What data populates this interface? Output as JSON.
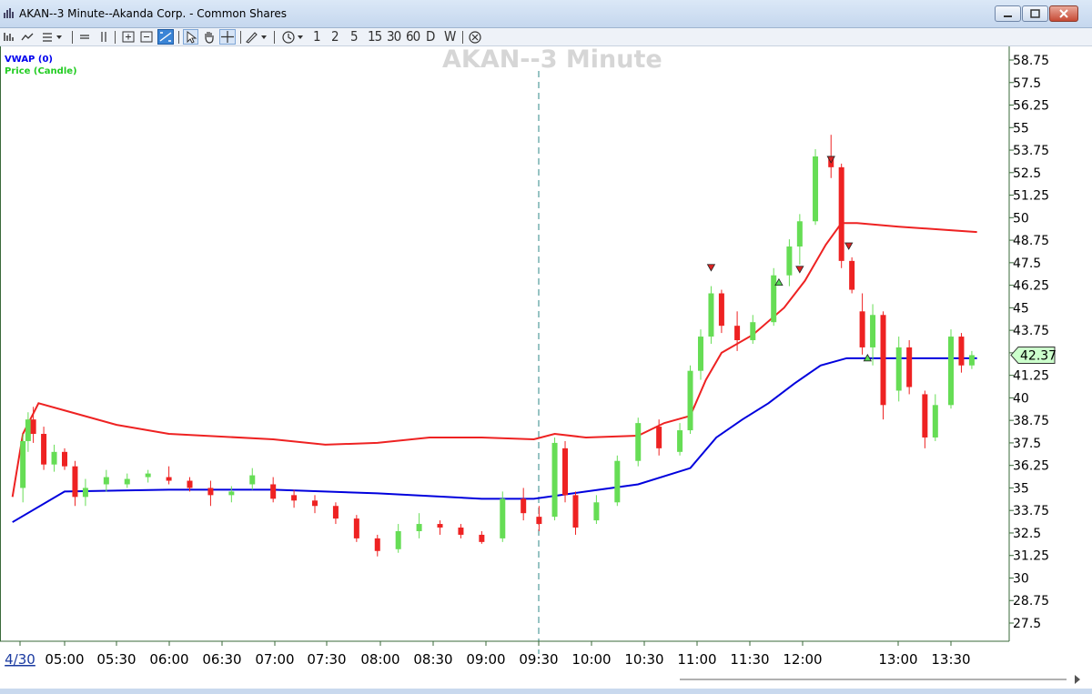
{
  "window": {
    "title": "AKAN--3 Minute--Akanda Corp. - Common Shares"
  },
  "toolbar": {
    "timeframes": [
      "1",
      "2",
      "5",
      "15",
      "30",
      "60",
      "D",
      "W"
    ]
  },
  "legend": {
    "vwap_label": "VWAP (0)",
    "price_label": "Price (Candle)"
  },
  "watermark": "AKAN--3 Minute",
  "colors": {
    "up_candle": "#66dd55",
    "down_candle": "#ee2222",
    "vwap_line": "#0000dd",
    "band_line": "#ee2222",
    "last_price_box": "#ccffcc"
  },
  "chart_data": {
    "type": "candlestick",
    "y_axis": {
      "ticks": [
        "58.75",
        "57.5",
        "56.25",
        "55",
        "53.75",
        "52.5",
        "51.25",
        "50",
        "48.75",
        "47.5",
        "46.25",
        "45",
        "43.75",
        "42.5",
        "41.25",
        "40",
        "38.75",
        "37.5",
        "36.25",
        "35",
        "33.75",
        "32.5",
        "31.25",
        "30",
        "28.75",
        "27.5"
      ],
      "range": [
        26.5,
        59.5
      ],
      "last_price": "42.37"
    },
    "x_axis": {
      "ticks": [
        "4/30",
        "05:00",
        "05:30",
        "06:00",
        "06:30",
        "07:00",
        "07:30",
        "08:00",
        "08:30",
        "09:00",
        "09:30",
        "10:00",
        "10:30",
        "11:00",
        "11:30",
        "12:00",
        "13:00",
        "13:30"
      ],
      "session_divider": "09:30"
    },
    "vwap_series": [
      [
        4.5,
        33.1
      ],
      [
        5.0,
        34.8
      ],
      [
        6.0,
        34.9
      ],
      [
        7.0,
        34.9
      ],
      [
        8.0,
        34.7
      ],
      [
        9.0,
        34.4
      ],
      [
        9.5,
        34.4
      ],
      [
        10.0,
        34.8
      ],
      [
        10.5,
        35.2
      ],
      [
        11.0,
        36.1
      ],
      [
        11.25,
        37.8
      ],
      [
        11.5,
        38.8
      ],
      [
        11.75,
        39.7
      ],
      [
        12.0,
        40.8
      ],
      [
        12.25,
        41.8
      ],
      [
        12.5,
        42.2
      ],
      [
        13.0,
        42.2
      ],
      [
        13.75,
        42.2
      ]
    ],
    "upper_band_series": [
      [
        4.5,
        34.5
      ],
      [
        4.6,
        38.0
      ],
      [
        4.75,
        39.7
      ],
      [
        5.0,
        39.3
      ],
      [
        5.5,
        38.5
      ],
      [
        6.0,
        38.0
      ],
      [
        7.0,
        37.7
      ],
      [
        7.5,
        37.4
      ],
      [
        8.0,
        37.5
      ],
      [
        8.5,
        37.8
      ],
      [
        9.0,
        37.8
      ],
      [
        9.5,
        37.7
      ],
      [
        9.7,
        38.0
      ],
      [
        10.0,
        37.8
      ],
      [
        10.5,
        37.9
      ],
      [
        10.75,
        38.6
      ],
      [
        11.0,
        39.0
      ],
      [
        11.15,
        41.0
      ],
      [
        11.3,
        42.5
      ],
      [
        11.6,
        43.5
      ],
      [
        11.9,
        45.0
      ],
      [
        12.1,
        46.5
      ],
      [
        12.3,
        48.5
      ],
      [
        12.45,
        49.7
      ],
      [
        12.6,
        49.7
      ],
      [
        13.0,
        49.5
      ],
      [
        13.75,
        49.2
      ]
    ],
    "candles_approx": [
      {
        "t": 4.6,
        "o": 35.0,
        "h": 38.0,
        "l": 34.2,
        "c": 37.6
      },
      {
        "t": 4.65,
        "o": 37.6,
        "h": 39.2,
        "l": 37.0,
        "c": 38.8
      },
      {
        "t": 4.7,
        "o": 38.8,
        "h": 39.5,
        "l": 37.5,
        "c": 38.0
      },
      {
        "t": 4.8,
        "o": 38.0,
        "h": 38.4,
        "l": 36.0,
        "c": 36.3
      },
      {
        "t": 4.9,
        "o": 36.3,
        "h": 37.4,
        "l": 35.9,
        "c": 37.0
      },
      {
        "t": 5.0,
        "o": 37.0,
        "h": 37.2,
        "l": 36.0,
        "c": 36.2
      },
      {
        "t": 5.1,
        "o": 36.2,
        "h": 36.5,
        "l": 34.0,
        "c": 34.5
      },
      {
        "t": 5.2,
        "o": 34.5,
        "h": 35.5,
        "l": 34.0,
        "c": 35.0
      },
      {
        "t": 5.4,
        "o": 35.2,
        "h": 36.0,
        "l": 34.8,
        "c": 35.6
      },
      {
        "t": 5.6,
        "o": 35.2,
        "h": 35.8,
        "l": 35.0,
        "c": 35.5
      },
      {
        "t": 5.8,
        "o": 35.6,
        "h": 36.0,
        "l": 35.3,
        "c": 35.8
      },
      {
        "t": 6.0,
        "o": 35.6,
        "h": 36.2,
        "l": 35.2,
        "c": 35.4
      },
      {
        "t": 6.2,
        "o": 35.4,
        "h": 35.6,
        "l": 34.8,
        "c": 35.0
      },
      {
        "t": 6.4,
        "o": 35.0,
        "h": 35.4,
        "l": 34.0,
        "c": 34.6
      },
      {
        "t": 6.6,
        "o": 34.6,
        "h": 35.1,
        "l": 34.2,
        "c": 34.8
      },
      {
        "t": 6.8,
        "o": 35.2,
        "h": 36.1,
        "l": 34.9,
        "c": 35.7
      },
      {
        "t": 7.0,
        "o": 35.2,
        "h": 35.6,
        "l": 34.2,
        "c": 34.4
      },
      {
        "t": 7.2,
        "o": 34.6,
        "h": 34.9,
        "l": 33.9,
        "c": 34.3
      },
      {
        "t": 7.4,
        "o": 34.3,
        "h": 34.6,
        "l": 33.6,
        "c": 34.0
      },
      {
        "t": 7.6,
        "o": 34.0,
        "h": 34.2,
        "l": 33.0,
        "c": 33.3
      },
      {
        "t": 7.8,
        "o": 33.3,
        "h": 33.5,
        "l": 32.0,
        "c": 32.2
      },
      {
        "t": 8.0,
        "o": 32.2,
        "h": 32.4,
        "l": 31.2,
        "c": 31.5
      },
      {
        "t": 8.2,
        "o": 31.6,
        "h": 33.0,
        "l": 31.4,
        "c": 32.6
      },
      {
        "t": 8.4,
        "o": 32.6,
        "h": 33.6,
        "l": 32.2,
        "c": 33.0
      },
      {
        "t": 8.6,
        "o": 33.0,
        "h": 33.2,
        "l": 32.4,
        "c": 32.8
      },
      {
        "t": 8.8,
        "o": 32.8,
        "h": 33.0,
        "l": 32.2,
        "c": 32.4
      },
      {
        "t": 9.0,
        "o": 32.4,
        "h": 32.6,
        "l": 31.9,
        "c": 32.0
      },
      {
        "t": 9.2,
        "o": 32.2,
        "h": 34.8,
        "l": 32.0,
        "c": 34.4
      },
      {
        "t": 9.4,
        "o": 34.4,
        "h": 35.0,
        "l": 33.2,
        "c": 33.6
      },
      {
        "t": 9.55,
        "o": 33.4,
        "h": 34.0,
        "l": 32.6,
        "c": 33.0
      },
      {
        "t": 9.7,
        "o": 33.4,
        "h": 37.8,
        "l": 33.2,
        "c": 37.5
      },
      {
        "t": 9.8,
        "o": 37.2,
        "h": 37.6,
        "l": 34.2,
        "c": 34.6
      },
      {
        "t": 9.9,
        "o": 34.6,
        "h": 34.8,
        "l": 32.4,
        "c": 32.8
      },
      {
        "t": 10.1,
        "o": 33.2,
        "h": 34.6,
        "l": 33.0,
        "c": 34.2
      },
      {
        "t": 10.3,
        "o": 34.2,
        "h": 36.8,
        "l": 34.0,
        "c": 36.5
      },
      {
        "t": 10.5,
        "o": 36.5,
        "h": 38.9,
        "l": 36.2,
        "c": 38.6
      },
      {
        "t": 10.7,
        "o": 38.4,
        "h": 38.8,
        "l": 36.8,
        "c": 37.2
      },
      {
        "t": 10.9,
        "o": 37.0,
        "h": 38.6,
        "l": 36.8,
        "c": 38.2
      },
      {
        "t": 11.0,
        "o": 38.2,
        "h": 41.8,
        "l": 38.0,
        "c": 41.5
      },
      {
        "t": 11.1,
        "o": 41.5,
        "h": 43.8,
        "l": 41.0,
        "c": 43.4
      },
      {
        "t": 11.2,
        "o": 43.4,
        "h": 46.2,
        "l": 43.0,
        "c": 45.8
      },
      {
        "t": 11.3,
        "o": 45.8,
        "h": 46.0,
        "l": 43.6,
        "c": 44.0
      },
      {
        "t": 11.45,
        "o": 44.0,
        "h": 44.8,
        "l": 42.6,
        "c": 43.2
      },
      {
        "t": 11.6,
        "o": 43.2,
        "h": 44.6,
        "l": 43.0,
        "c": 44.2
      },
      {
        "t": 11.8,
        "o": 44.2,
        "h": 47.2,
        "l": 44.0,
        "c": 46.8
      },
      {
        "t": 11.95,
        "o": 46.8,
        "h": 48.8,
        "l": 46.2,
        "c": 48.4
      },
      {
        "t": 12.05,
        "o": 48.4,
        "h": 50.2,
        "l": 47.4,
        "c": 49.8
      },
      {
        "t": 12.2,
        "o": 49.8,
        "h": 53.8,
        "l": 49.6,
        "c": 53.4
      },
      {
        "t": 12.35,
        "o": 53.4,
        "h": 54.6,
        "l": 52.2,
        "c": 52.8
      },
      {
        "t": 12.45,
        "o": 52.8,
        "h": 53.0,
        "l": 47.2,
        "c": 47.6
      },
      {
        "t": 12.55,
        "o": 47.6,
        "h": 47.8,
        "l": 45.8,
        "c": 46.0
      },
      {
        "t": 12.65,
        "o": 44.8,
        "h": 45.8,
        "l": 42.4,
        "c": 42.8
      },
      {
        "t": 12.75,
        "o": 42.8,
        "h": 45.2,
        "l": 41.8,
        "c": 44.6
      },
      {
        "t": 12.85,
        "o": 44.6,
        "h": 44.8,
        "l": 38.8,
        "c": 39.6
      },
      {
        "t": 13.0,
        "o": 40.4,
        "h": 43.4,
        "l": 39.8,
        "c": 42.8
      },
      {
        "t": 13.1,
        "o": 42.8,
        "h": 43.2,
        "l": 40.2,
        "c": 40.6
      },
      {
        "t": 13.25,
        "o": 40.2,
        "h": 40.4,
        "l": 37.2,
        "c": 37.8
      },
      {
        "t": 13.35,
        "o": 37.8,
        "h": 40.2,
        "l": 37.6,
        "c": 39.6
      },
      {
        "t": 13.5,
        "o": 39.6,
        "h": 43.8,
        "l": 39.4,
        "c": 43.4
      },
      {
        "t": 13.6,
        "o": 43.4,
        "h": 43.6,
        "l": 41.4,
        "c": 41.8
      },
      {
        "t": 13.7,
        "o": 41.8,
        "h": 42.6,
        "l": 41.6,
        "c": 42.37
      }
    ]
  }
}
